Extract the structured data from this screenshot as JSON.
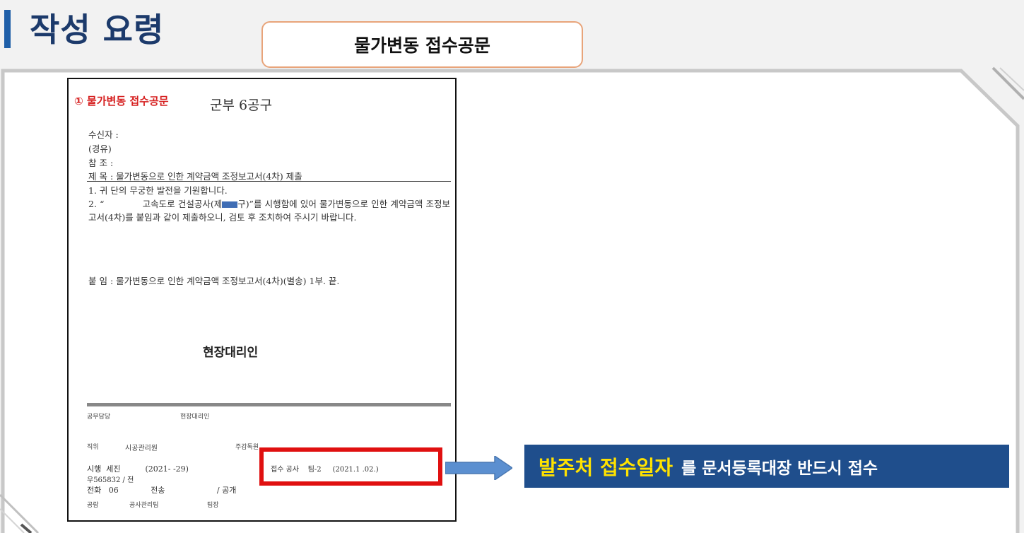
{
  "header": {
    "title": "작성 요령",
    "tab_label": "물가변동 접수공문"
  },
  "document": {
    "label": "① 물가변동 접수공문",
    "header_right": "군부 6공구",
    "recipient": "수신자 :",
    "via": "(경유)",
    "reference": "참  조 :",
    "subject": "제  목 : 물가변동으로 인한 계약금액 조정보고서(4차) 제출",
    "body_line1": "1. 귀 단의 무궁한 발전을 기원합니다.",
    "body_line2_a": "2. “",
    "body_line2_b": "고속도로 건설공사(제",
    "body_line2_c": "구)”를 시행함에 있어 물가변동으로 인한 계약금액 조정보고서(4차)를 붙임과 같이 제출하오니, 검토 후 조치하여 주시기 바랍니다.",
    "attachment": "붙    임 : 물가변동으로 인한 계약금액 조정보고서(4차)(별송)  1부.   끝.",
    "signature": "현장대리인",
    "footer": {
      "staff_label": "공무담당",
      "agent_label": "현장대리인",
      "position_label": "직위",
      "position_value": "시공관리원",
      "supervisor_label": "주감독원",
      "enforce_label": "시행",
      "enforce_value": "세진",
      "enforce_date": "(2021-   -29)",
      "receipt_label": "접수  공사",
      "receipt_value": "팀-2",
      "receipt_date": "(2021.1  .02.)",
      "zip": "우565832 / 전",
      "phone_label": "전화",
      "phone_value": "06",
      "fax_label": "전송",
      "public_label": "/ 공개",
      "cooperation_label": "공람",
      "cooperation_value": "공사관리팀",
      "team_leader_label": "팀장"
    }
  },
  "callout": {
    "highlight": "발주처 접수일자",
    "rest": "를 문서등록대장 반드시 접수"
  },
  "colors": {
    "title": "#1c3a6b",
    "title_bar": "#1f5fa8",
    "tab_border": "#e8a47a",
    "red_box": "#e01010",
    "arrow": "#5b8fd0",
    "callout_bg": "#1f4e8c",
    "callout_highlight": "#ffe200"
  }
}
